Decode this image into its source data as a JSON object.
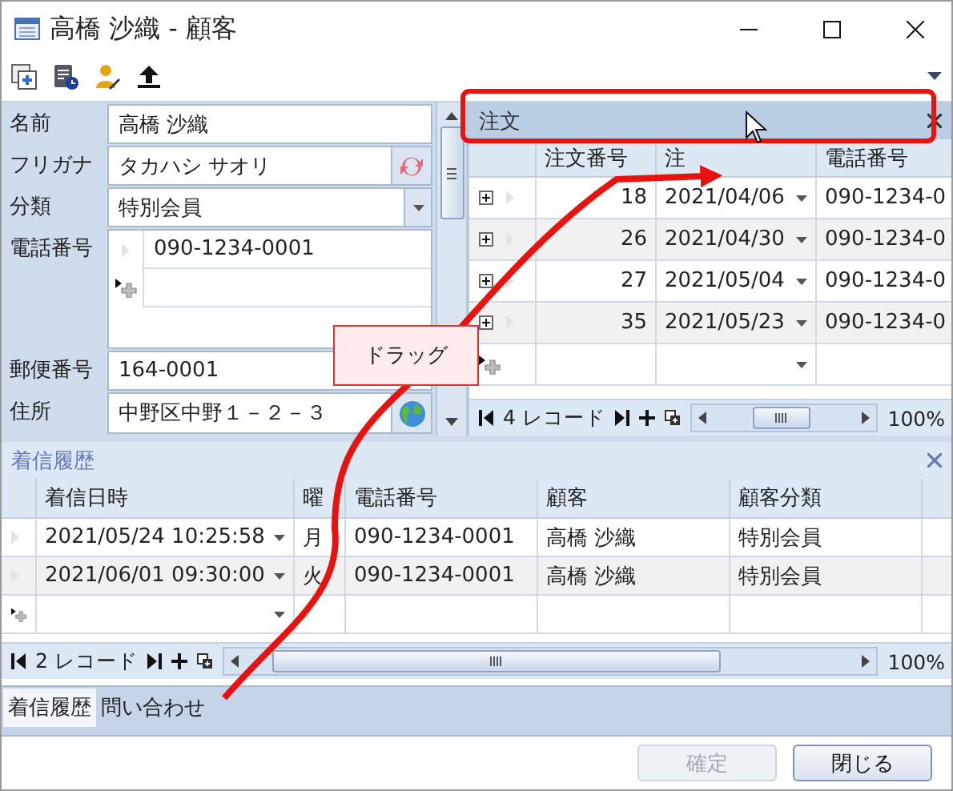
{
  "window": {
    "title": "高橋 沙織 - 顧客"
  },
  "form": {
    "fields": [
      {
        "label": "名前",
        "kind": "text",
        "value": "高橋 沙織"
      },
      {
        "label": "フリガナ",
        "kind": "refresh",
        "value": "タカハシ サオリ"
      },
      {
        "label": "分類",
        "kind": "dropdown",
        "value": "特別会員"
      },
      {
        "label": "電話番号",
        "kind": "list",
        "values": [
          "090-1234-0001"
        ]
      },
      {
        "label": "郵便番号",
        "kind": "text",
        "value": "164-0001"
      },
      {
        "label": "住所",
        "kind": "globe",
        "value": "中野区中野１－２－３"
      }
    ]
  },
  "orders": {
    "title": "注文",
    "columns": [
      "注文番号",
      "注",
      "電話番号"
    ],
    "rows": [
      {
        "order_no": "18",
        "date": "2021/04/06",
        "phone": "090-1234-0"
      },
      {
        "order_no": "26",
        "date": "2021/04/30",
        "phone": "090-1234-0"
      },
      {
        "order_no": "27",
        "date": "2021/05/04",
        "phone": "090-1234-0"
      },
      {
        "order_no": "35",
        "date": "2021/05/23",
        "phone": "090-1234-0"
      }
    ],
    "record_count": "4 レコード",
    "zoom": "100%"
  },
  "calls": {
    "title": "着信履歴",
    "columns": [
      "着信日時",
      "曜",
      "電話番号",
      "顧客",
      "顧客分類"
    ],
    "rows": [
      {
        "datetime": "2021/05/24 10:25:58",
        "weekday": "月",
        "phone": "090-1234-0001",
        "customer": "高橋 沙織",
        "category": "特別会員"
      },
      {
        "datetime": "2021/06/01 09:30:00",
        "weekday": "火",
        "phone": "090-1234-0001",
        "customer": "高橋 沙織",
        "category": "特別会員"
      }
    ],
    "record_count": "2 レコード",
    "zoom": "100%"
  },
  "tabs": [
    {
      "label": "着信履歴",
      "selected": true
    },
    {
      "label": "問い合わせ",
      "selected": false
    }
  ],
  "buttons": [
    {
      "label": "確定",
      "disabled": true
    },
    {
      "label": "閉じる",
      "disabled": false
    }
  ],
  "annotation": {
    "callout": "ドラッグ"
  }
}
